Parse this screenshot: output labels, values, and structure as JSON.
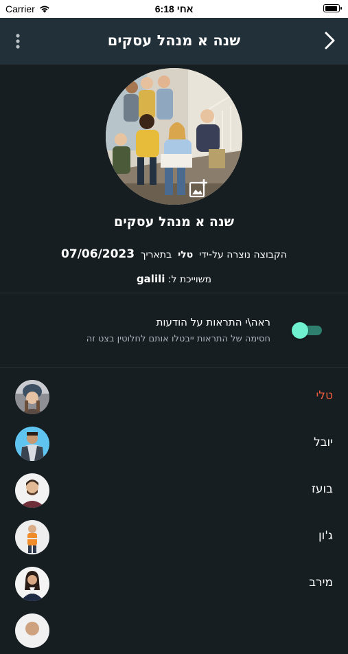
{
  "status_bar": {
    "carrier": "Carrier",
    "time": "6:18 אחי"
  },
  "header": {
    "title": "שנה א מנהל עסקים",
    "back_icon": "chevron-right-icon",
    "menu_icon": "more-vertical-icon"
  },
  "group": {
    "name": "שנה א מנהל עסקים",
    "created_prefix": "הקבוצה נוצרה על-ידי",
    "creator": "טלי",
    "created_on_label": "בתאריך",
    "created_date": "07/06/2023",
    "belongs_label": "משוייכת ל:",
    "belongs_to": "galili"
  },
  "notifications": {
    "title": "ראה\\י התראות על הודעות",
    "subtitle": "חסימה של התראות ייבטלו אותם לחלוטין בצט זה",
    "enabled": true,
    "accent_color": "#6ff0cf"
  },
  "members": [
    {
      "name": "טלי",
      "is_admin": true
    },
    {
      "name": "יובל",
      "is_admin": false
    },
    {
      "name": "בועז",
      "is_admin": false
    },
    {
      "name": "ג'ון",
      "is_admin": false
    },
    {
      "name": "מירב",
      "is_admin": false
    }
  ],
  "colors": {
    "admin_name": "#ef5a3c",
    "navbar": "#22303a",
    "background": "#161e22"
  }
}
